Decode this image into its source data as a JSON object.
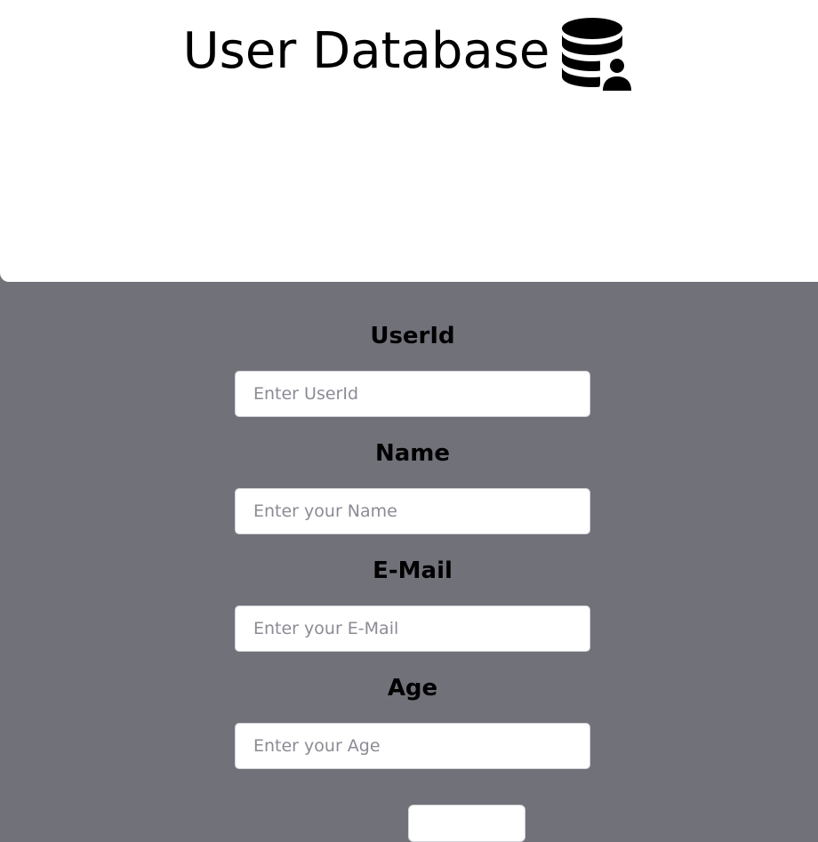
{
  "header": {
    "title": "User Database",
    "icon": "database-user-icon"
  },
  "form": {
    "fields": [
      {
        "label": "UserId",
        "placeholder": "Enter UserId",
        "value": ""
      },
      {
        "label": "Name",
        "placeholder": "Enter your Name",
        "value": ""
      },
      {
        "label": "E-Mail",
        "placeholder": "Enter your E-Mail",
        "value": ""
      },
      {
        "label": "Age",
        "placeholder": "Enter your Age",
        "value": ""
      }
    ]
  },
  "colors": {
    "background": "#71717a",
    "header_background": "#ffffff",
    "input_background": "#ffffff",
    "text": "#000000",
    "placeholder": "#8b8b95"
  }
}
